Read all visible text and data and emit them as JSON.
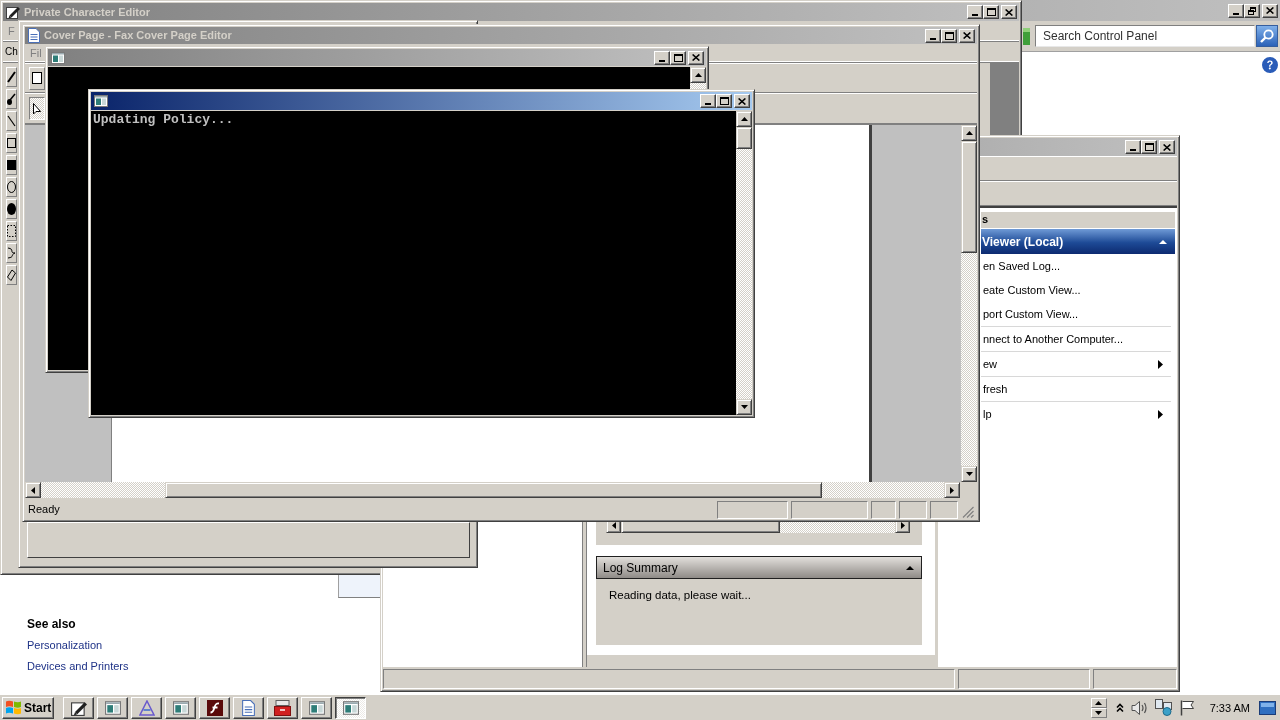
{
  "control_panel": {
    "active": false,
    "search": {
      "placeholder": "Search Control Panel"
    },
    "see_also": {
      "heading": "See also",
      "links": [
        "Personalization",
        "Devices and Printers"
      ]
    }
  },
  "character_editor": {
    "title": "Private Character Editor",
    "active": false,
    "menu": [
      {
        "label": "F",
        "disabled": true
      }
    ],
    "bar_label": "Ch"
  },
  "event_viewer": {
    "active": false,
    "actions_header": "s",
    "section": {
      "title": "Viewer (Local)",
      "expanded": true
    },
    "actions": [
      {
        "label": "en Saved Log...",
        "submenu": false,
        "separator_before": false
      },
      {
        "label": "eate Custom View...",
        "submenu": false,
        "separator_before": false
      },
      {
        "label": "port Custom View...",
        "submenu": false,
        "separator_before": false
      },
      {
        "label": "nnect to Another Computer...",
        "submenu": false,
        "separator_before": true
      },
      {
        "label": "ew",
        "submenu": true,
        "separator_before": true
      },
      {
        "label": "fresh",
        "submenu": false,
        "separator_before": true
      },
      {
        "label": "lp",
        "submenu": true,
        "separator_before": true
      }
    ],
    "log_summary": {
      "title": "Log Summary",
      "expanded": true,
      "message": "Reading data, please wait..."
    }
  },
  "fax_editor": {
    "title": "Cover Page - Fax Cover Page Editor",
    "active": false,
    "menu": [
      {
        "label": "Fil",
        "disabled": true
      }
    ],
    "tools": [
      {
        "kind": "page",
        "selected": false
      },
      {
        "kind": "pointer",
        "selected": true
      }
    ],
    "status": "Ready"
  },
  "consoles": [
    {
      "active": false
    },
    {
      "active": true,
      "text": "Updating Policy..."
    }
  ],
  "taskbar": {
    "start": "Start",
    "buttons": [
      {
        "kind": "pencil",
        "selected": false
      },
      {
        "kind": "console",
        "selected": false
      },
      {
        "kind": "triangle",
        "selected": false
      },
      {
        "kind": "console",
        "selected": false
      },
      {
        "kind": "swoosh",
        "selected": false
      },
      {
        "kind": "document",
        "selected": false
      },
      {
        "kind": "toolbox",
        "selected": false
      },
      {
        "kind": "console",
        "selected": false
      },
      {
        "kind": "console",
        "selected": true
      }
    ],
    "clock": "7:33 AM"
  }
}
